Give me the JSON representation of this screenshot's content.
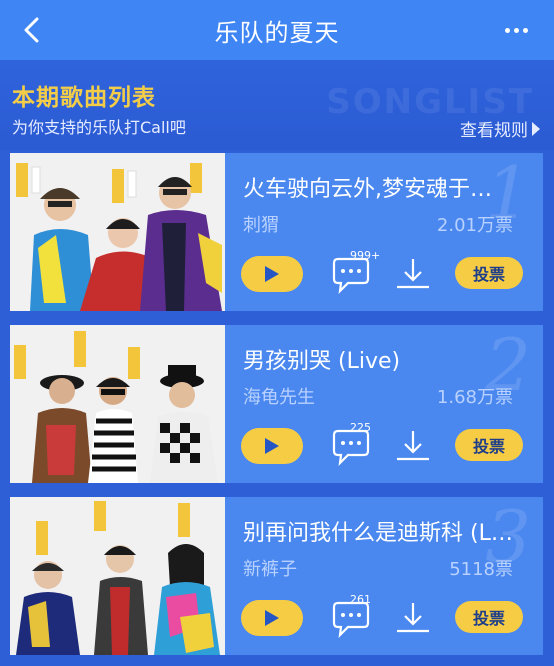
{
  "header": {
    "title": "乐队的夏天"
  },
  "section": {
    "title": "本期歌曲列表",
    "subtitle": "为你支持的乐队打Call吧",
    "watermark": "SONGLIST",
    "rules_link": "查看规则"
  },
  "songs": [
    {
      "rank": "1",
      "title": "火车驶向云外,梦安魂于…",
      "artist": "刺猬",
      "votes": "2.01万票",
      "comments": "999+",
      "vote_label": "投票"
    },
    {
      "rank": "2",
      "title": "男孩别哭 (Live)",
      "artist": "海龟先生",
      "votes": "1.68万票",
      "comments": "225",
      "vote_label": "投票"
    },
    {
      "rank": "3",
      "title": "别再问我什么是迪斯科 (L…",
      "artist": "新裤子",
      "votes": "5118票",
      "comments": "261",
      "vote_label": "投票"
    }
  ],
  "colors": {
    "header": "#3f86f4",
    "background": "#2f5fd6",
    "card": "#4a88ef",
    "accent": "#f6cc45"
  },
  "icons": [
    "back-arrow-icon",
    "more-dots-icon",
    "play-icon",
    "comment-icon",
    "download-icon"
  ]
}
